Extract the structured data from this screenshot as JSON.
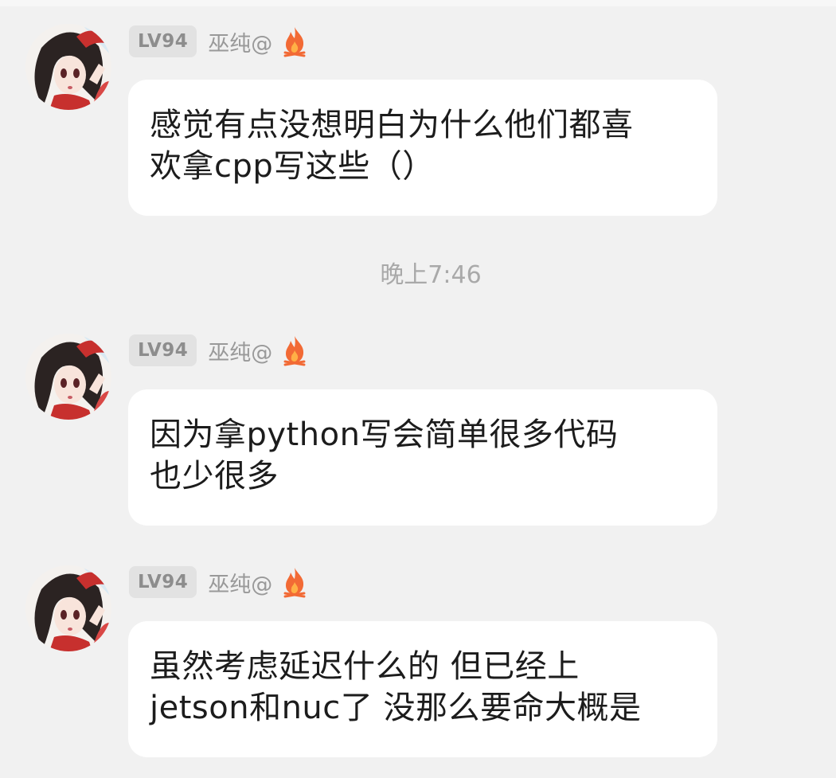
{
  "colors": {
    "background": "#f1f1f1",
    "bubble": "#ffffff",
    "badge_bg": "#e2e2e2",
    "badge_text": "#8d8d8d",
    "nickname": "#999999",
    "timestamp": "#a9a9a9",
    "message_text": "#1c1c1c",
    "fire": "#f26a35"
  },
  "divider": {
    "timestamp": "晚上7:46"
  },
  "messages": [
    {
      "sender": {
        "level": "LV94",
        "nickname": "巫纯@",
        "badge_icon": "fire-icon",
        "avatar": "avatar"
      },
      "lines": [
        "感觉有点没想明白为什么他们都喜",
        "欢拿cpp写这些（）"
      ]
    },
    {
      "sender": {
        "level": "LV94",
        "nickname": "巫纯@",
        "badge_icon": "fire-icon",
        "avatar": "avatar"
      },
      "lines": [
        "因为拿python写会简单很多代码",
        "也少很多"
      ]
    },
    {
      "sender": {
        "level": "LV94",
        "nickname": "巫纯@",
        "badge_icon": "fire-icon",
        "avatar": "avatar"
      },
      "lines": [
        "虽然考虑延迟什么的 但已经上",
        "jetson和nuc了 没那么要命大概是"
      ]
    }
  ]
}
